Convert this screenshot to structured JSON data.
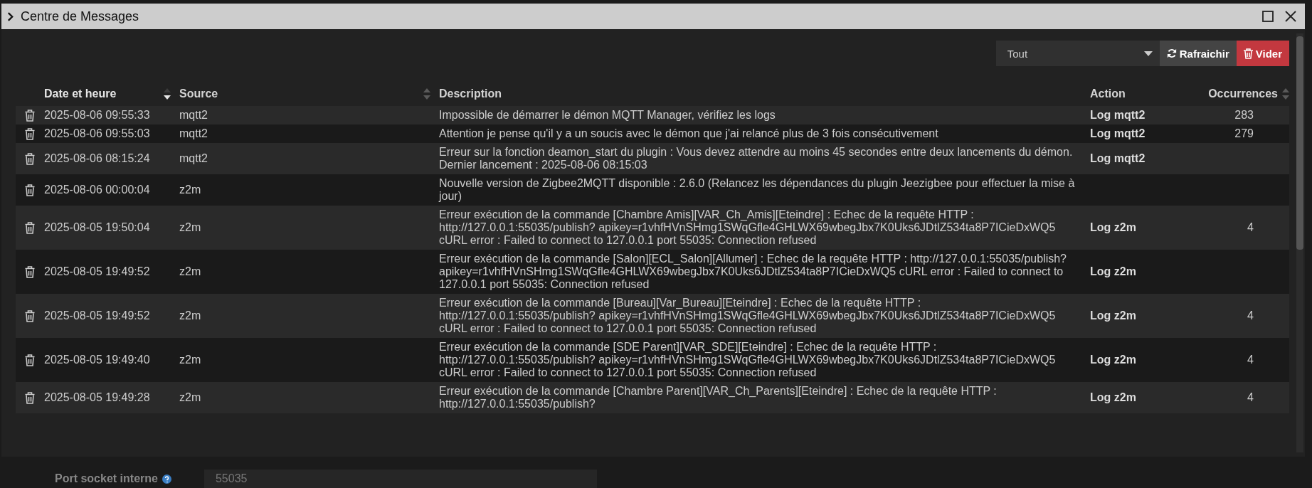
{
  "window": {
    "title": "Centre de Messages"
  },
  "toolbar": {
    "filter": {
      "value": "Tout"
    },
    "buttons": [
      {
        "label": "Rafraichir",
        "kind": "refresh"
      },
      {
        "label": "Vider",
        "kind": "clear"
      }
    ]
  },
  "table": {
    "columns": [
      {
        "label": "Date et heure",
        "sortable": true,
        "sorted": true
      },
      {
        "label": "Source",
        "sortable": true,
        "sorted": false
      },
      {
        "label": "Description",
        "sortable": false,
        "sorted": false
      },
      {
        "label": "Action",
        "sortable": false,
        "sorted": false
      },
      {
        "label": "Occurrences",
        "sortable": true,
        "sorted": false
      }
    ],
    "rows": [
      {
        "date": "2025-08-06 09:55:33",
        "source": "mqtt2",
        "description": "Impossible de démarrer le démon MQTT Manager, vérifiez les logs",
        "action": "Log mqtt2",
        "occurrences": "283"
      },
      {
        "date": "2025-08-06 09:55:03",
        "source": "mqtt2",
        "description": "Attention je pense qu'il y a un soucis avec le démon que j'ai relancé plus de 3 fois consécutivement",
        "action": "Log mqtt2",
        "occurrences": "279"
      },
      {
        "date": "2025-08-06 08:15:24",
        "source": "mqtt2",
        "description": "Erreur sur la fonction deamon_start du plugin : Vous devez attendre au moins 45 secondes entre deux lancements du démon. Dernier lancement : 2025-08-06 08:15:03",
        "action": "Log mqtt2"
      },
      {
        "date": "2025-08-06 00:00:04",
        "source": "z2m",
        "description": "Nouvelle version de Zigbee2MQTT disponible : 2.6.0 (Relancez les dépendances du plugin Jeezigbee pour effectuer la mise à jour)"
      },
      {
        "date": "2025-08-05 19:50:04",
        "source": "z2m",
        "description": "Erreur exécution de la commande [Chambre Amis][VAR_Ch_Amis][Eteindre] : Echec de la requête HTTP : http://127.0.0.1:55035/publish? apikey=r1vhfHVnSHmg1SWqGfle4GHLWX69wbegJbx7K0Uks6JDtlZ534ta8P7ICieDxWQ5 cURL error : Failed to connect to 127.0.0.1 port 55035: Connection refused",
        "action": "Log z2m",
        "occurrences": "4"
      },
      {
        "date": "2025-08-05 19:49:52",
        "source": "z2m",
        "description": "Erreur exécution de la commande [Salon][ECL_Salon][Allumer] : Echec de la requête HTTP : http://127.0.0.1:55035/publish? apikey=r1vhfHVnSHmg1SWqGfle4GHLWX69wbegJbx7K0Uks6JDtlZ534ta8P7ICieDxWQ5 cURL error : Failed to connect to 127.0.0.1 port 55035: Connection refused",
        "action": "Log z2m"
      },
      {
        "date": "2025-08-05 19:49:52",
        "source": "z2m",
        "description": "Erreur exécution de la commande [Bureau][Var_Bureau][Eteindre] : Echec de la requête HTTP : http://127.0.0.1:55035/publish? apikey=r1vhfHVnSHmg1SWqGfle4GHLWX69wbegJbx7K0Uks6JDtlZ534ta8P7ICieDxWQ5 cURL error : Failed to connect to 127.0.0.1 port 55035: Connection refused",
        "action": "Log z2m",
        "occurrences": "4"
      },
      {
        "date": "2025-08-05 19:49:40",
        "source": "z2m",
        "description": "Erreur exécution de la commande [SDE Parent][VAR_SDE][Eteindre] : Echec de la requête HTTP : http://127.0.0.1:55035/publish? apikey=r1vhfHVnSHmg1SWqGfle4GHLWX69wbegJbx7K0Uks6JDtlZ534ta8P7ICieDxWQ5 cURL error : Failed to connect to 127.0.0.1 port 55035: Connection refused",
        "action": "Log z2m",
        "occurrences": "4"
      },
      {
        "date": "2025-08-05 19:49:28",
        "source": "z2m",
        "description": "Erreur exécution de la commande [Chambre Parent][VAR_Ch_Parents][Eteindre] : Echec de la requête HTTP : http://127.0.0.1:55035/publish?",
        "action": "Log z2m",
        "occurrences": "4"
      }
    ]
  },
  "background": {
    "field_label": "Port socket interne",
    "field_value": "55035"
  }
}
